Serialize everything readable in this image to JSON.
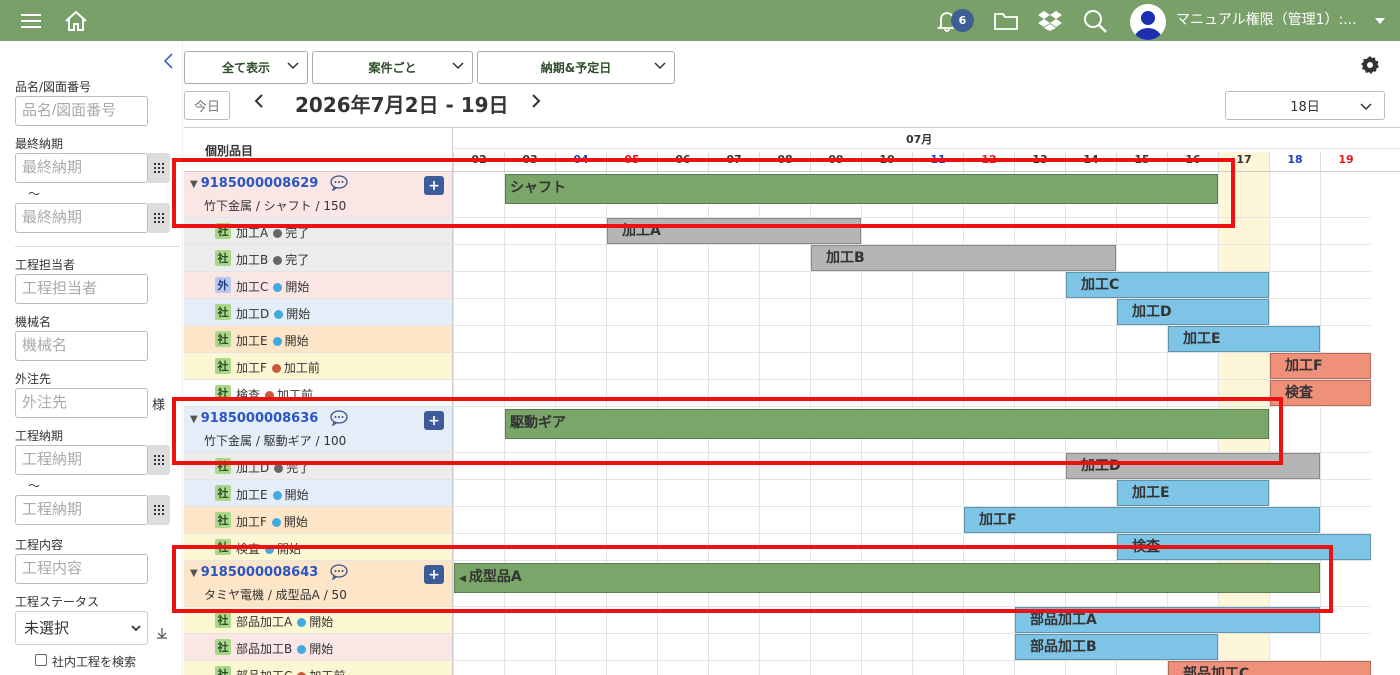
{
  "topbar": {
    "notif_count": "6",
    "username": "マニュアル権限（管理1）:..."
  },
  "sidebar": {
    "part_label": "品名/図面番号",
    "part_placeholder": "品名/図面番号",
    "final_due_label": "最終納期",
    "final_due_placeholder": "最終納期",
    "tilde": "〜",
    "owner_label": "工程担当者",
    "owner_placeholder": "工程担当者",
    "machine_label": "機械名",
    "machine_placeholder": "機械名",
    "vendor_label": "外注先",
    "vendor_placeholder": "外注先",
    "vendor_suffix": "様",
    "proc_due_label": "工程納期",
    "proc_due_placeholder": "工程納期",
    "content_label": "工程内容",
    "content_placeholder": "工程内容",
    "status_label": "工程ステータス",
    "status_value": "未選択",
    "inhouse_checkbox": "社内工程を検索"
  },
  "toolbar": {
    "filter1": "全て表示",
    "filter2": "案件ごと",
    "filter3": "納期&予定日",
    "today": "今日",
    "range": "2026年7月2日 - 19日",
    "days": "18日"
  },
  "gantt": {
    "header_label": "個別品目",
    "month": "07月",
    "days": [
      {
        "d": "02",
        "c": "#333"
      },
      {
        "d": "03",
        "c": "#333"
      },
      {
        "d": "04",
        "c": "#1f3fcf"
      },
      {
        "d": "05",
        "c": "#e01b1b"
      },
      {
        "d": "06",
        "c": "#333"
      },
      {
        "d": "07",
        "c": "#333"
      },
      {
        "d": "08",
        "c": "#333"
      },
      {
        "d": "09",
        "c": "#333"
      },
      {
        "d": "10",
        "c": "#333"
      },
      {
        "d": "11",
        "c": "#1f3fcf"
      },
      {
        "d": "12",
        "c": "#e01b1b"
      },
      {
        "d": "13",
        "c": "#333"
      },
      {
        "d": "14",
        "c": "#333"
      },
      {
        "d": "15",
        "c": "#333"
      },
      {
        "d": "16",
        "c": "#333"
      },
      {
        "d": "17",
        "c": "#333"
      },
      {
        "d": "18",
        "c": "#1f3fcf"
      },
      {
        "d": "19",
        "c": "#e01b1b"
      }
    ],
    "today_index": 15,
    "rows": [
      {
        "kind": "parent",
        "id": "9185000008629",
        "sub": "竹下金属 / シャフト / 150",
        "bg": "#fbe6e6",
        "bar": {
          "label": "シャフト",
          "start": 1,
          "end": 15,
          "color": "#7aa66a"
        }
      },
      {
        "kind": "proc",
        "tag": "社",
        "name": "加工A",
        "status": "完了",
        "dot": "#666666",
        "bg": "#ececec",
        "bar": {
          "label": "加工A",
          "start": 3,
          "end": 8,
          "color": "#b5b5b5"
        }
      },
      {
        "kind": "proc",
        "tag": "社",
        "name": "加工B",
        "status": "完了",
        "dot": "#666666",
        "bg": "#ececec",
        "bar": {
          "label": "加工B",
          "start": 7,
          "end": 13,
          "color": "#b5b5b5"
        }
      },
      {
        "kind": "proc",
        "tag": "外",
        "name": "加工C",
        "status": "開始",
        "dot": "#3fa9e0",
        "bg": "#fbe6e6",
        "bar": {
          "label": "加工C",
          "start": 12,
          "end": 16,
          "color": "#7ec4e6"
        }
      },
      {
        "kind": "proc",
        "tag": "社",
        "name": "加工D",
        "status": "開始",
        "dot": "#3fa9e0",
        "bg": "#e4edf8",
        "bar": {
          "label": "加工D",
          "start": 13,
          "end": 16,
          "color": "#7ec4e6"
        }
      },
      {
        "kind": "proc",
        "tag": "社",
        "name": "加工E",
        "status": "開始",
        "dot": "#3fa9e0",
        "bg": "#fde5c8",
        "bar": {
          "label": "加工E",
          "start": 14,
          "end": 17,
          "color": "#7ec4e6"
        }
      },
      {
        "kind": "proc",
        "tag": "社",
        "name": "加工F",
        "status": "加工前",
        "dot": "#c8593b",
        "bg": "#fdf6d2",
        "bar": {
          "label": "加工F",
          "start": 16,
          "end": 18,
          "color": "#ef907a"
        }
      },
      {
        "kind": "proc",
        "tag": "社",
        "name": "検査",
        "status": "加工前",
        "dot": "#c8593b",
        "bg": "#ffffff",
        "bar": {
          "label": "検査",
          "start": 16,
          "end": 18,
          "color": "#ef907a"
        }
      },
      {
        "kind": "parent",
        "id": "9185000008636",
        "sub": "竹下金属 / 駆動ギア / 100",
        "bg": "#e4edf8",
        "bar": {
          "label": "駆動ギア",
          "start": 1,
          "end": 16,
          "color": "#7aa66a"
        }
      },
      {
        "kind": "proc",
        "tag": "社",
        "name": "加工D",
        "status": "完了",
        "dot": "#666666",
        "bg": "#ececec",
        "bar": {
          "label": "加工D",
          "start": 12,
          "end": 17,
          "color": "#b5b5b5"
        }
      },
      {
        "kind": "proc",
        "tag": "社",
        "name": "加工E",
        "status": "開始",
        "dot": "#3fa9e0",
        "bg": "#e4edf8",
        "bar": {
          "label": "加工E",
          "start": 13,
          "end": 16,
          "color": "#7ec4e6"
        }
      },
      {
        "kind": "proc",
        "tag": "社",
        "name": "加工F",
        "status": "開始",
        "dot": "#3fa9e0",
        "bg": "#fde5c8",
        "bar": {
          "label": "加工F",
          "start": 10,
          "end": 17,
          "color": "#7ec4e6"
        }
      },
      {
        "kind": "proc",
        "tag": "社",
        "name": "検査",
        "status": "開始",
        "dot": "#3fa9e0",
        "bg": "#fdf6d2",
        "bar": {
          "label": "検査",
          "start": 13,
          "end": 18,
          "color": "#7ec4e6"
        }
      },
      {
        "kind": "parent",
        "id": "9185000008643",
        "sub": "タミヤ電機 / 成型品A / 50",
        "bg": "#fde5c8",
        "bar": {
          "label": "成型品A",
          "start": 0,
          "end": 17,
          "color": "#7aa66a"
        }
      },
      {
        "kind": "proc",
        "tag": "社",
        "name": "部品加工A",
        "status": "開始",
        "dot": "#3fa9e0",
        "bg": "#fdf6d2",
        "bar": {
          "label": "部品加工A",
          "start": 11,
          "end": 17,
          "color": "#7ec4e6"
        }
      },
      {
        "kind": "proc",
        "tag": "社",
        "name": "部品加工B",
        "status": "開始",
        "dot": "#3fa9e0",
        "bg": "#fbe6e6",
        "bar": {
          "label": "部品加工B",
          "start": 11,
          "end": 15,
          "color": "#7ec4e6"
        }
      },
      {
        "kind": "proc",
        "tag": "社",
        "name": "部品加工C",
        "status": "加工前",
        "dot": "#c8593b",
        "bg": "#fdf6d2",
        "bar": {
          "label": "部品加工C",
          "start": 14,
          "end": 18,
          "color": "#ef907a"
        }
      }
    ]
  }
}
